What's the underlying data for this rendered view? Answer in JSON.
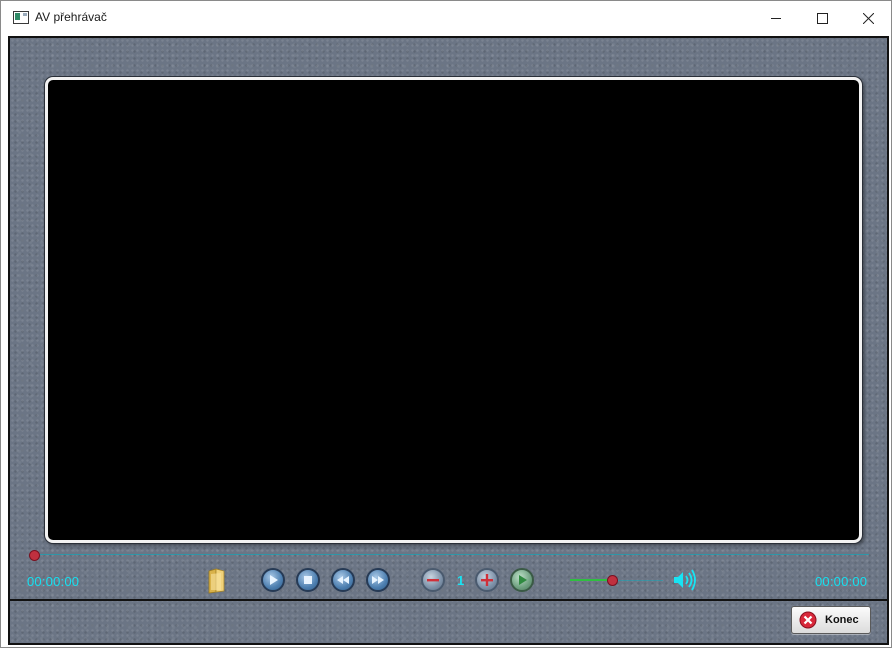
{
  "window": {
    "title": "AV přehrávač"
  },
  "player": {
    "time_elapsed": "00:00:00",
    "time_total": "00:00:00",
    "speed": "1",
    "seek_position": 0,
    "volume_level": 0.55
  },
  "controls": {
    "icons": [
      "folder-icon",
      "play-icon",
      "stop-icon",
      "rewind-icon",
      "fast-forward-icon",
      "speed-down-icon",
      "speed-up-icon",
      "next-icon",
      "speaker-icon"
    ]
  },
  "footer": {
    "exit_label": "Konec"
  },
  "colors": {
    "background": "#6b7585",
    "time_text": "#15e0f0",
    "seek_thumb": "#c0303f",
    "volume_fill": "#2fbf40"
  }
}
